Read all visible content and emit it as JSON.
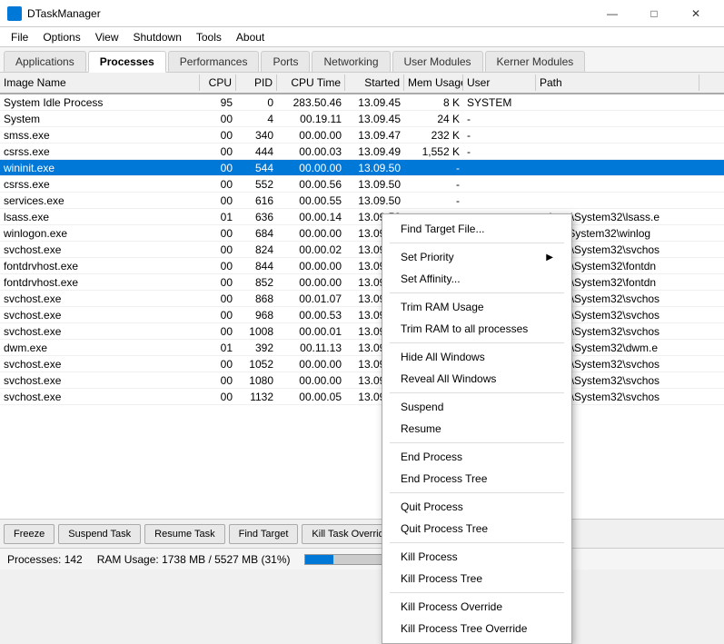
{
  "app": {
    "title": "DTaskManager",
    "icon": "taskmgr-icon"
  },
  "win_controls": {
    "minimize": "—",
    "maximize": "□",
    "close": "✕"
  },
  "menu": {
    "items": [
      "File",
      "Options",
      "View",
      "Shutdown",
      "Tools",
      "About"
    ]
  },
  "tabs": [
    {
      "label": "Applications",
      "active": false
    },
    {
      "label": "Processes",
      "active": true
    },
    {
      "label": "Performances",
      "active": false
    },
    {
      "label": "Ports",
      "active": false
    },
    {
      "label": "Networking",
      "active": false
    },
    {
      "label": "User Modules",
      "active": false
    },
    {
      "label": "Kerner Modules",
      "active": false
    }
  ],
  "table": {
    "columns": [
      {
        "label": "Image Name",
        "cls": "col-name"
      },
      {
        "label": "CPU",
        "cls": "col-cpu"
      },
      {
        "label": "PID",
        "cls": "col-pid"
      },
      {
        "label": "CPU Time",
        "cls": "col-cputime"
      },
      {
        "label": "Started",
        "cls": "col-started"
      },
      {
        "label": "Mem Usage",
        "cls": "col-mem"
      },
      {
        "label": "User",
        "cls": "col-user"
      },
      {
        "label": "Path",
        "cls": "col-path"
      }
    ],
    "rows": [
      {
        "name": "System Idle Process",
        "cpu": "95",
        "pid": "0",
        "cputime": "283.50.46",
        "started": "13.09.45",
        "mem": "8 K",
        "user": "SYSTEM",
        "path": "",
        "selected": false
      },
      {
        "name": "System",
        "cpu": "00",
        "pid": "4",
        "cputime": "00.19.11",
        "started": "13.09.45",
        "mem": "24 K",
        "user": "-",
        "path": "",
        "selected": false
      },
      {
        "name": "smss.exe",
        "cpu": "00",
        "pid": "340",
        "cputime": "00.00.00",
        "started": "13.09.47",
        "mem": "232 K",
        "user": "-",
        "path": "",
        "selected": false
      },
      {
        "name": "csrss.exe",
        "cpu": "00",
        "pid": "444",
        "cputime": "00.00.03",
        "started": "13.09.49",
        "mem": "1,552 K",
        "user": "-",
        "path": "",
        "selected": false
      },
      {
        "name": "wininit.exe",
        "cpu": "00",
        "pid": "544",
        "cputime": "00.00.00",
        "started": "13.09.50",
        "mem": "-",
        "user": "",
        "path": "",
        "selected": true
      },
      {
        "name": "csrss.exe",
        "cpu": "00",
        "pid": "552",
        "cputime": "00.00.56",
        "started": "13.09.50",
        "mem": "-",
        "user": "",
        "path": "",
        "selected": false
      },
      {
        "name": "services.exe",
        "cpu": "00",
        "pid": "616",
        "cputime": "00.00.55",
        "started": "13.09.50",
        "mem": "-",
        "user": "",
        "path": "",
        "selected": false
      },
      {
        "name": "lsass.exe",
        "cpu": "01",
        "pid": "636",
        "cputime": "00.00.14",
        "started": "13.09.50",
        "mem": "-",
        "user": "",
        "path": "ndows\\System32\\lsass.e",
        "selected": false
      },
      {
        "name": "winlogon.exe",
        "cpu": "00",
        "pid": "684",
        "cputime": "00.00.00",
        "started": "13.09.50",
        "mem": "-",
        "user": "",
        "path": "dows\\System32\\winlog",
        "selected": false
      },
      {
        "name": "svchost.exe",
        "cpu": "00",
        "pid": "824",
        "cputime": "00.00.02",
        "started": "13.09.50",
        "mem": "-",
        "user": "",
        "path": "ndows\\System32\\svchos",
        "selected": false
      },
      {
        "name": "fontdrvhost.exe",
        "cpu": "00",
        "pid": "844",
        "cputime": "00.00.00",
        "started": "13.09.50",
        "mem": "-",
        "user": "",
        "path": "ndows\\System32\\fontdn",
        "selected": false
      },
      {
        "name": "fontdrvhost.exe",
        "cpu": "00",
        "pid": "852",
        "cputime": "00.00.00",
        "started": "13.09.50",
        "mem": "-",
        "user": "",
        "path": "ndows\\System32\\fontdn",
        "selected": false
      },
      {
        "name": "svchost.exe",
        "cpu": "00",
        "pid": "868",
        "cputime": "00.01.07",
        "started": "13.09.50",
        "mem": "-",
        "user": "",
        "path": "ndows\\System32\\svchos",
        "selected": false
      },
      {
        "name": "svchost.exe",
        "cpu": "00",
        "pid": "968",
        "cputime": "00.00.53",
        "started": "13.09.50",
        "mem": "-",
        "user": "",
        "path": "ndows\\System32\\svchos",
        "selected": false
      },
      {
        "name": "svchost.exe",
        "cpu": "00",
        "pid": "1008",
        "cputime": "00.00.01",
        "started": "13.09.50",
        "mem": "-",
        "user": "",
        "path": "ndows\\System32\\svchos",
        "selected": false
      },
      {
        "name": "dwm.exe",
        "cpu": "01",
        "pid": "392",
        "cputime": "00.11.13",
        "started": "13.09.50",
        "mem": "-",
        "user": "",
        "path": "ndows\\System32\\dwm.e",
        "selected": false
      },
      {
        "name": "svchost.exe",
        "cpu": "00",
        "pid": "1052",
        "cputime": "00.00.00",
        "started": "13.09.51",
        "mem": "-",
        "user": "",
        "path": "ndows\\System32\\svchos",
        "selected": false
      },
      {
        "name": "svchost.exe",
        "cpu": "00",
        "pid": "1080",
        "cputime": "00.00.00",
        "started": "13.09.51",
        "mem": "-",
        "user": "",
        "path": "ndows\\System32\\svchos",
        "selected": false
      },
      {
        "name": "svchost.exe",
        "cpu": "00",
        "pid": "1132",
        "cputime": "00.00.05",
        "started": "13.09.51",
        "mem": "-",
        "user": "",
        "path": "ndows\\System32\\svchos",
        "selected": false
      }
    ]
  },
  "context_menu": {
    "items": [
      {
        "label": "Find Target File...",
        "type": "item",
        "separator_after": true
      },
      {
        "label": "Set Priority",
        "type": "item",
        "arrow": true,
        "separator_after": false
      },
      {
        "label": "Set Affinity...",
        "type": "item",
        "separator_after": true
      },
      {
        "label": "Trim RAM Usage",
        "type": "item",
        "separator_after": false
      },
      {
        "label": "Trim RAM to all processes",
        "type": "item",
        "separator_after": true
      },
      {
        "label": "Hide All Windows",
        "type": "item",
        "separator_after": false
      },
      {
        "label": "Reveal All Windows",
        "type": "item",
        "separator_after": true
      },
      {
        "label": "Suspend",
        "type": "item",
        "separator_after": false
      },
      {
        "label": "Resume",
        "type": "item",
        "separator_after": true
      },
      {
        "label": "End Process",
        "type": "item",
        "separator_after": false
      },
      {
        "label": "End Process Tree",
        "type": "item",
        "separator_after": true
      },
      {
        "label": "Quit Process",
        "type": "item",
        "separator_after": false
      },
      {
        "label": "Quit Process Tree",
        "type": "item",
        "separator_after": true
      },
      {
        "label": "Kill Process",
        "type": "item",
        "separator_after": false
      },
      {
        "label": "Kill Process Tree",
        "type": "item",
        "separator_after": true
      },
      {
        "label": "Kill Process Override",
        "type": "item",
        "separator_after": false
      },
      {
        "label": "Kill Process Tree Override",
        "type": "item",
        "separator_after": false
      }
    ]
  },
  "toolbar": {
    "buttons": [
      "Freeze",
      "Suspend Task",
      "Resume Task",
      "Find Target",
      "Kill Task Override"
    ]
  },
  "status": {
    "processes": "Processes: 142",
    "ram": "RAM Usage: 1738 MB / 5527 MB (31%)",
    "progress_pct": 31
  }
}
